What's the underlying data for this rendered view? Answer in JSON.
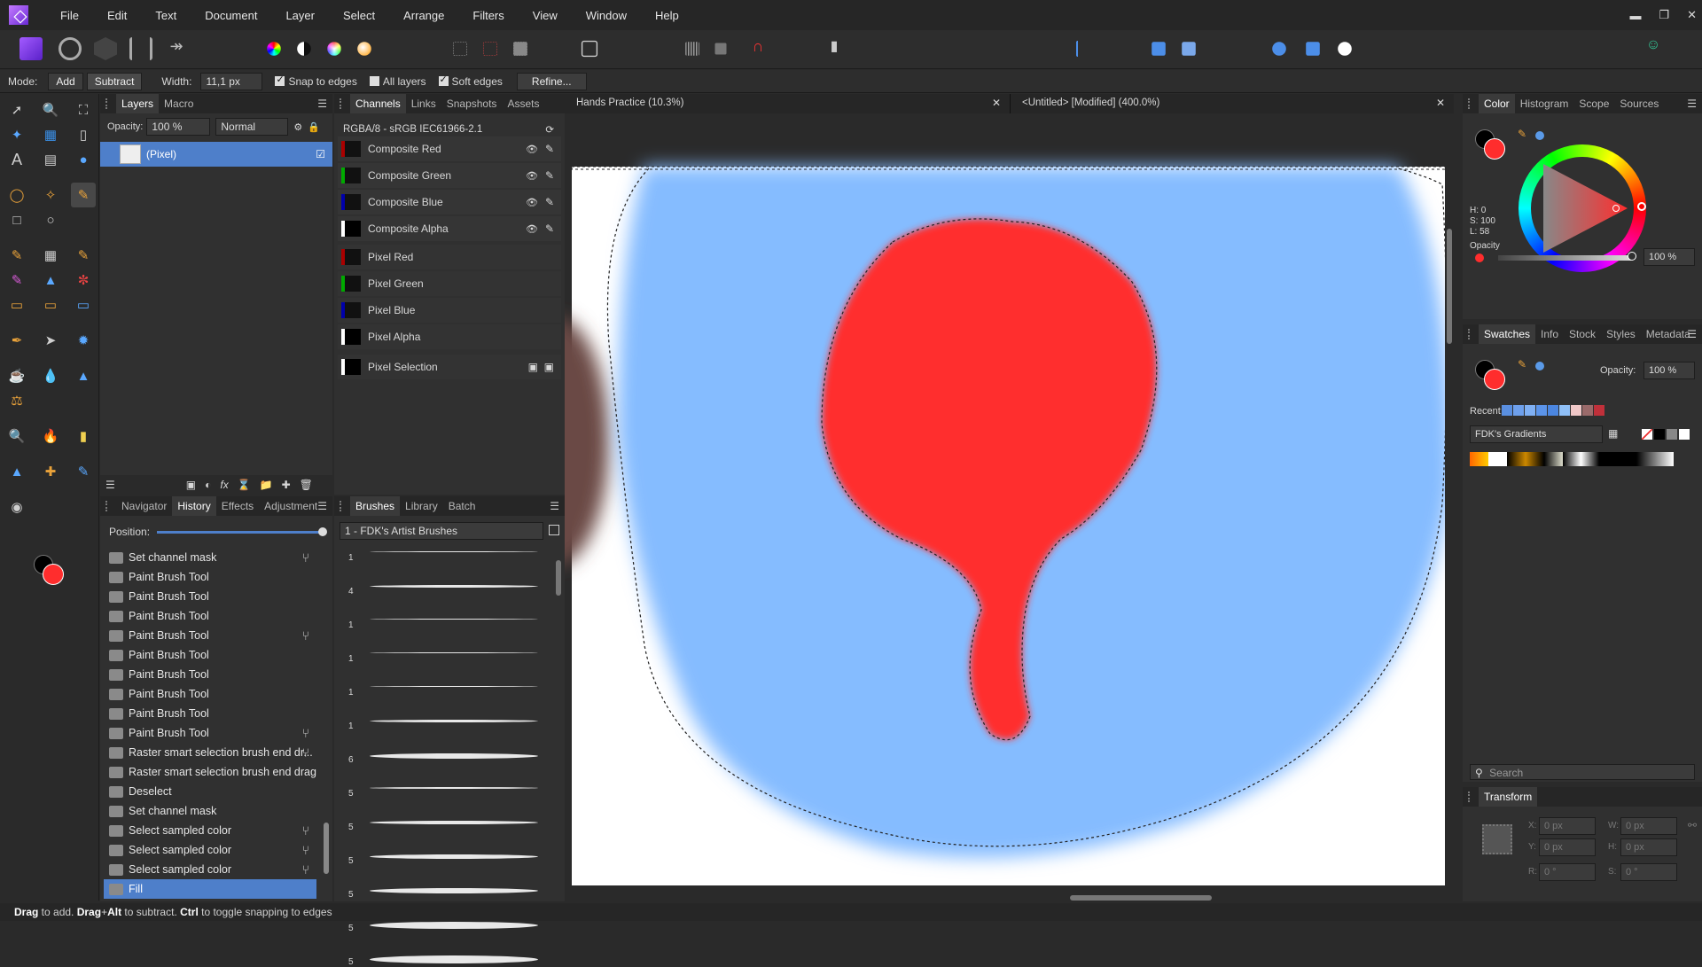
{
  "menu": [
    "File",
    "Edit",
    "Text",
    "Document",
    "Layer",
    "Select",
    "Arrange",
    "Filters",
    "View",
    "Window",
    "Help"
  ],
  "context": {
    "mode_label": "Mode:",
    "add": "Add",
    "subtract": "Subtract",
    "width_label": "Width:",
    "width_value": "11,1 px",
    "snap": "Snap to edges",
    "all_layers": "All layers",
    "soft_edges": "Soft edges",
    "refine": "Refine..."
  },
  "layers_panel": {
    "tabs": [
      "Layers",
      "Macro"
    ],
    "opacity_label": "Opacity:",
    "opacity_value": "100 %",
    "blend_mode": "Normal",
    "layer_name": "(Pixel)"
  },
  "channels_panel": {
    "tabs": [
      "Channels",
      "Links",
      "Snapshots",
      "Assets"
    ],
    "format": "RGBA/8 - sRGB IEC61966-2.1",
    "channels": [
      "Composite Red",
      "Composite Green",
      "Composite Blue",
      "Composite Alpha",
      "Pixel Red",
      "Pixel Green",
      "Pixel Blue",
      "Pixel Alpha",
      "Pixel Selection"
    ]
  },
  "history_panel": {
    "tabs": [
      "Navigator",
      "History",
      "Effects",
      "Adjustment"
    ],
    "position_label": "Position:",
    "items": [
      "Set channel mask",
      "Paint Brush Tool",
      "Paint Brush Tool",
      "Paint Brush Tool",
      "Paint Brush Tool",
      "Paint Brush Tool",
      "Paint Brush Tool",
      "Paint Brush Tool",
      "Paint Brush Tool",
      "Paint Brush Tool",
      "Raster smart selection brush end dr...",
      "Raster smart selection brush end drag",
      "Deselect",
      "Set channel mask",
      "Select sampled color",
      "Select sampled color",
      "Select sampled color",
      "Fill"
    ]
  },
  "brushes_panel": {
    "tabs": [
      "Brushes",
      "Library",
      "Batch"
    ],
    "category": "1 - FDK's Artist Brushes",
    "sizes": [
      "1",
      "4",
      "1",
      "1",
      "1",
      "1",
      "6",
      "5",
      "5",
      "5",
      "5",
      "5",
      "5"
    ]
  },
  "documents": {
    "tab1": "Hands Practice (10.3%)",
    "tab2": "<Untitled> [Modified] (400.0%)"
  },
  "color_panel": {
    "tabs": [
      "Color",
      "Histogram",
      "Scope",
      "Sources"
    ],
    "h": "H: 0",
    "s": "S: 100",
    "l": "L: 58",
    "opacity_label": "Opacity",
    "opacity_value": "100 %"
  },
  "swatches_panel": {
    "tabs": [
      "Swatches",
      "Info",
      "Stock",
      "Styles",
      "Metadata"
    ],
    "opacity_label": "Opacity:",
    "opacity_value": "100 %",
    "recent_label": "Recent:",
    "palette": "FDK's Gradients",
    "recent_colors": [
      "#5a8fe0",
      "#6ea0ec",
      "#7fb0f4",
      "#5b94ea",
      "#4b86e0",
      "#8fbff6",
      "#f0c8c8",
      "#9a6a6a",
      "#c0303a"
    ],
    "search_placeholder": "Search"
  },
  "transform_panel": {
    "title": "Transform",
    "x": "0 px",
    "y": "0 px",
    "w": "0 px",
    "h": "0 px",
    "r": "0 °",
    "s": "0 °",
    "x_label": "X:",
    "y_label": "Y:",
    "w_label": "W:",
    "h_label": "H:",
    "r_label": "R:",
    "s_label": "S:"
  },
  "status": {
    "b1": "Drag",
    "t1": " to add. ",
    "b2": "Drag",
    "t2": "+",
    "b3": "Alt",
    "t3": " to subtract. ",
    "b4": "Ctrl",
    "t4": " to toggle snapping to edges"
  },
  "colors": {
    "accent": "#4e7fca",
    "red": "#ff2d2d",
    "blue": "#85bcff"
  }
}
